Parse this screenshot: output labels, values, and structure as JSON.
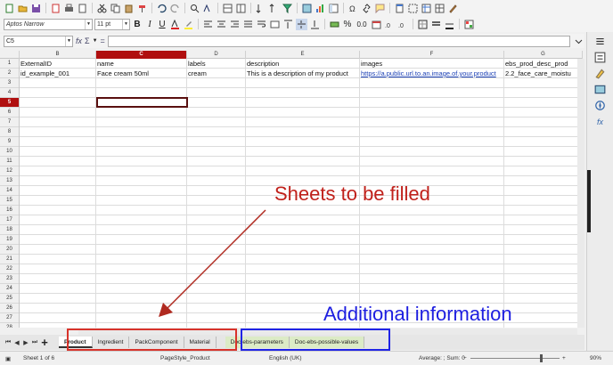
{
  "toolbar": {
    "font_name": "Aptos Narrow",
    "font_size": "11 pt",
    "bold": "B",
    "italic": "I",
    "underline": "U",
    "percent": "%",
    "decimal": "0.0"
  },
  "formula_bar": {
    "cell_ref": "C5",
    "fx": "fx",
    "sum": "Σ",
    "equals": "="
  },
  "columns": [
    "B",
    "C",
    "D",
    "E",
    "F",
    "G"
  ],
  "selected_column": "C",
  "rows": [
    "1",
    "2",
    "3",
    "4",
    "5",
    "6",
    "7",
    "8",
    "9",
    "10",
    "11",
    "12",
    "13",
    "14",
    "15",
    "16",
    "17",
    "18",
    "19",
    "20",
    "21",
    "22",
    "23",
    "24",
    "25",
    "26",
    "27",
    "28"
  ],
  "selected_row": "5",
  "sheet": {
    "header": [
      "ExternalID",
      "name",
      "labels",
      "description",
      "images",
      "ebs_prod_desc_prod"
    ],
    "row2": [
      "id_example_001",
      "Face cream 50ml",
      "cream",
      "This is a description of my product",
      "https://a.public.url.to.an.image.of.your.product",
      "2.2_face_care_moistu"
    ]
  },
  "annotations": {
    "sheets": "Sheets to be filled",
    "additional": "Additional information"
  },
  "tabs": {
    "main": [
      "Product",
      "Ingredient",
      "PackComponent",
      "Material"
    ],
    "info": [
      "Doc-ebs-parameters",
      "Doc-ebs-possible-values"
    ],
    "active": "Product"
  },
  "status": {
    "sheet": "Sheet 1 of 6",
    "style": "PageStyle_Product",
    "language": "English (UK)",
    "summary": "Average: ; Sum: 0",
    "zoom": "90%",
    "zoom_minus": "−",
    "zoom_plus": "+"
  },
  "colors": {
    "selection": "#b00f0f",
    "annotation_red": "#c0211b",
    "annotation_blue": "#1d1ee0",
    "info_tab": "#dcebc6"
  }
}
